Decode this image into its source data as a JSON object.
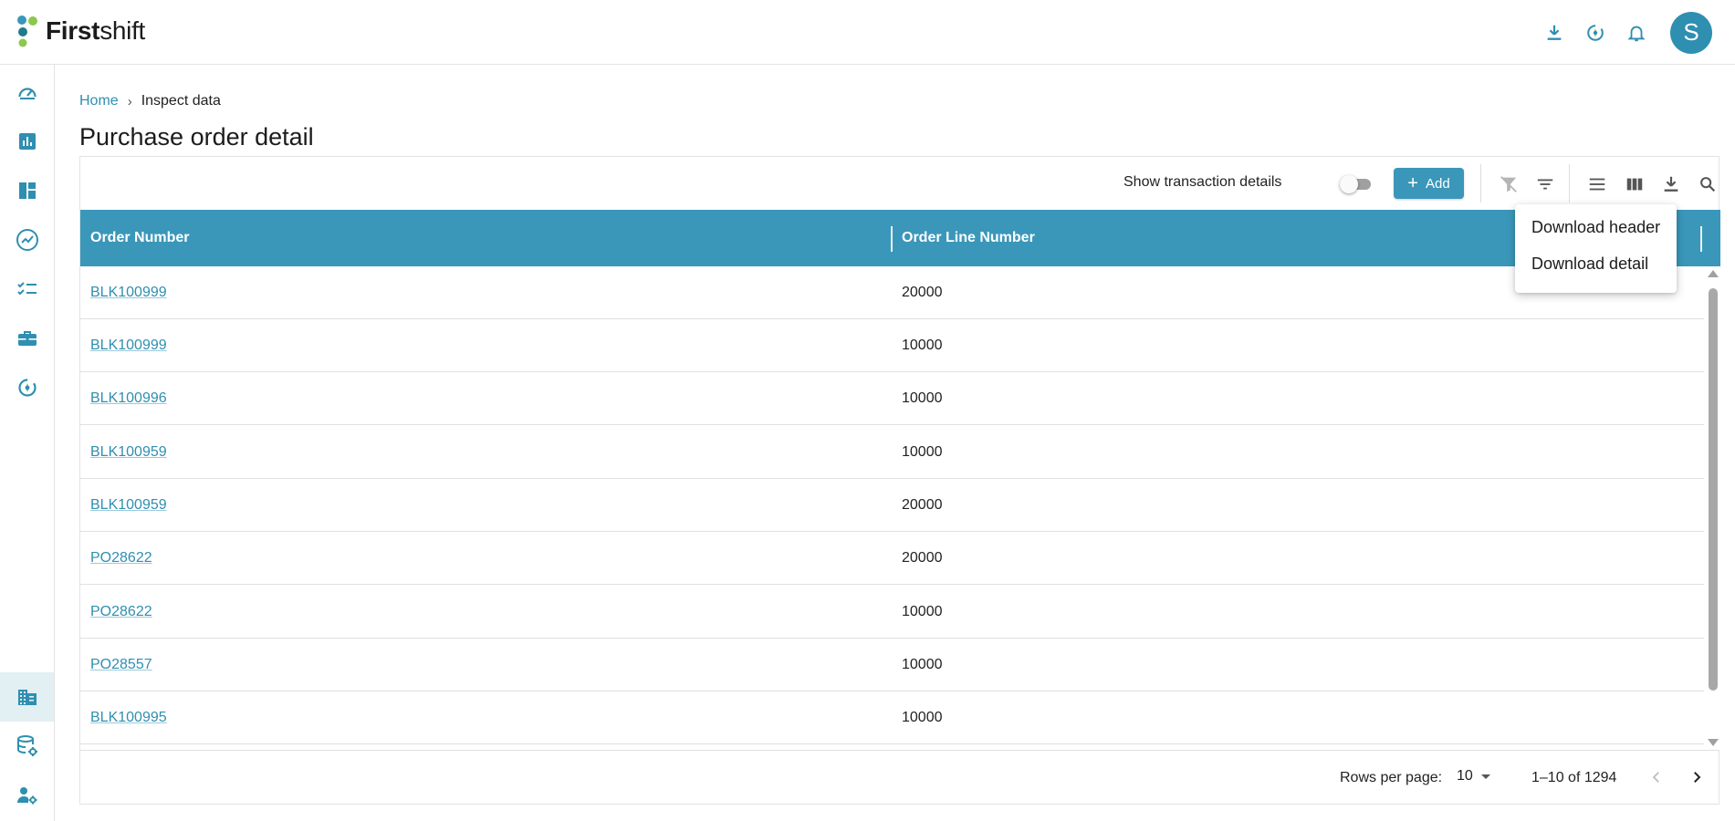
{
  "brand": {
    "name_bold": "First",
    "name_regular": "shift"
  },
  "topbar": {
    "icons": [
      "download-icon",
      "target-icon",
      "bell-icon"
    ],
    "avatar_initial": "S"
  },
  "sidebar": {
    "items": [
      "dashboard-icon",
      "bar-chart-icon",
      "layout-icon",
      "trend-icon",
      "checklist-icon",
      "briefcase-icon",
      "target-icon",
      "building-icon",
      "database-settings-icon",
      "user-settings-icon"
    ],
    "active_item": "building-icon"
  },
  "breadcrumb": {
    "home": "Home",
    "separator": "›",
    "current": "Inspect data"
  },
  "page_title": "Purchase order detail",
  "toolbar": {
    "toggle_label": "Show transaction details",
    "toggle_on": false,
    "add_label": "Add",
    "icons": [
      "clear-filter-icon",
      "filter-icon",
      "density-icon",
      "columns-icon",
      "download-icon",
      "search-icon"
    ]
  },
  "table": {
    "columns": [
      "Order Number",
      "Order Line Number"
    ],
    "rows": [
      [
        "BLK100999",
        "20000"
      ],
      [
        "BLK100999",
        "10000"
      ],
      [
        "BLK100996",
        "10000"
      ],
      [
        "BLK100959",
        "10000"
      ],
      [
        "BLK100959",
        "20000"
      ],
      [
        "PO28622",
        "20000"
      ],
      [
        "PO28622",
        "10000"
      ],
      [
        "PO28557",
        "10000"
      ],
      [
        "BLK100995",
        "10000"
      ]
    ]
  },
  "pagination": {
    "rows_per_page_label": "Rows per page:",
    "rows_per_page": "10",
    "range": "1–10 of 1294"
  },
  "download_menu": {
    "items": [
      "Download header",
      "Download detail"
    ]
  },
  "colors": {
    "accent": "#3a97b9",
    "link": "#2f8fb0",
    "active_side_bg": "#e2eff3",
    "header_bg": "#3a97b9"
  }
}
